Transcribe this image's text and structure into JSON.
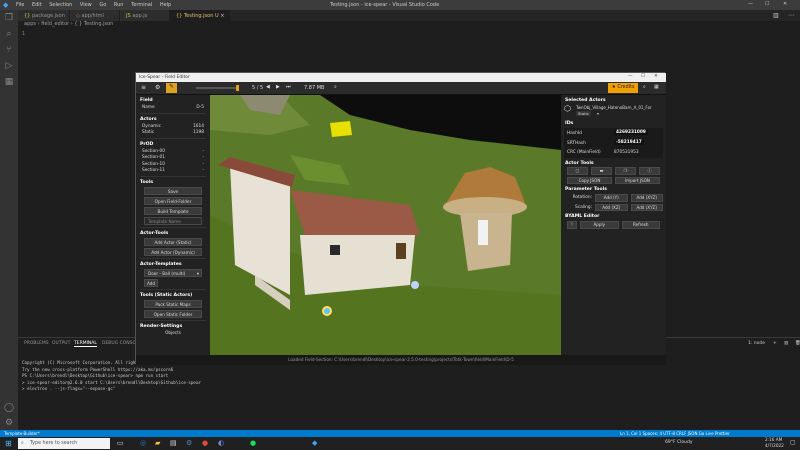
{
  "window": {
    "title": "Testing.json - ice-spear - Visual Studio Code",
    "menu": [
      "File",
      "Edit",
      "Selection",
      "View",
      "Go",
      "Run",
      "Terminal",
      "Help"
    ]
  },
  "tabs": [
    {
      "label": "package.json",
      "active": false
    },
    {
      "label": "app/html",
      "active": false
    },
    {
      "label": "app.js",
      "active": false
    },
    {
      "label": "Testing.json U",
      "active": true
    }
  ],
  "breadcrumb": "apps › field_editor › { } Testing.json",
  "editor": {
    "line_number": "1"
  },
  "field_editor": {
    "title": "Ice-Spear - Field Editor",
    "toolbar": {
      "page": "5 / 5",
      "memory": "7.87 MB",
      "credits": "Credits"
    },
    "left": {
      "field_header": "Field",
      "name_label": "Name",
      "name_value": "D-5",
      "actors_header": "Actors",
      "dynamic_label": "Dynamic",
      "dynamic_value": "1614",
      "static_label": "Static",
      "static_value": "1198",
      "prod_header": "PrOD",
      "sections": [
        {
          "name": "Section-00",
          "value": "-"
        },
        {
          "name": "Section-01",
          "value": "-"
        },
        {
          "name": "Section-10",
          "value": "-"
        },
        {
          "name": "Section-11",
          "value": "-"
        }
      ],
      "tools_header": "Tools",
      "save": "Save",
      "open_field_folder": "Open Field-Folder",
      "build_template": "Build Template",
      "template_name_placeholder": "Template Name",
      "actor_tools_header": "Actor-Tools",
      "add_actor_static": "Add Actor (Static)",
      "add_actor_dynamic": "Add Actor (Dynamic)",
      "actor_templates_header": "Actor-Templates",
      "template_select": "Door - Ball (multi)",
      "add": "Add",
      "tools_static_header": "Tools (Static Actors)",
      "pack_static_maps": "Pack Static Maps",
      "open_static_folder": "Open Static Folder",
      "render_settings_header": "Render-Settings",
      "objects": "Objects"
    },
    "right": {
      "selected_header": "Selected Actors",
      "actor_name": "TwnObj_Village_HatenoBarn_A_01_For",
      "actor_type": "Static",
      "ids_header": "IDs",
      "hashid_label": "HashId",
      "hashid_value": "4269231009",
      "srt_label": "SRTHash",
      "srt_value": "-58219417",
      "crc_label": "CRC (MainField)",
      "crc_value": "870531953",
      "actor_tools_header": "Actor Tools",
      "copy_json": "Copy JSON",
      "import_json": "Import JSON",
      "param_tools_header": "Parameter Tools",
      "rotation_label": "Rotation:",
      "add_y": "Add (Y)",
      "add_xyz": "Add (XYZ)",
      "scaling_label": "Scaling:",
      "add_xz": "Add (XZ)",
      "add_xyz2": "Add (XYZ)",
      "byaml_header": "BYAML Editor",
      "apply": "Apply",
      "refresh": "Refresh"
    },
    "status": "Loaded Field-Section: C:\\Users\\brendl\\Desktop\\ice-spear-2.5.0-testing\\projects\\Totk-Town\\field\\MainField\\D-5"
  },
  "panel": {
    "tabs": [
      "PROBLEMS",
      "OUTPUT",
      "TERMINAL",
      "DEBUG CONSOLE"
    ],
    "shell": "1: node"
  },
  "terminal_lines": [
    "Copyright (C) Microsoft Corporation. All rights reserved.",
    "",
    "Try the new cross-platform PowerShell https://aka.ms/pscore6",
    "",
    "PS C:\\Users\\brendl\\Desktop\\Github\\ice-spear> npm run start",
    "",
    "> ice-spear-editor@2.6.0 start C:\\Users\\brendl\\Desktop\\Github\\ice-spear",
    "> electron . --js-flags=\"--expose-gc\""
  ],
  "statusbar": {
    "left": "Template-Builder*",
    "right": "Ln 1, Col 1   Spaces: 4   UTF-8   CRLF   JSON   Go Live   Prettier"
  },
  "taskbar": {
    "search_placeholder": "Type here to search",
    "weather": "69°F  Cloudy",
    "time": "2:16 AM",
    "date": "4/7/2022"
  },
  "colors": {
    "accent": "#007acc",
    "credits": "#f0a000",
    "grass": "#5a7a2a",
    "sky": "#0d0d0d"
  }
}
